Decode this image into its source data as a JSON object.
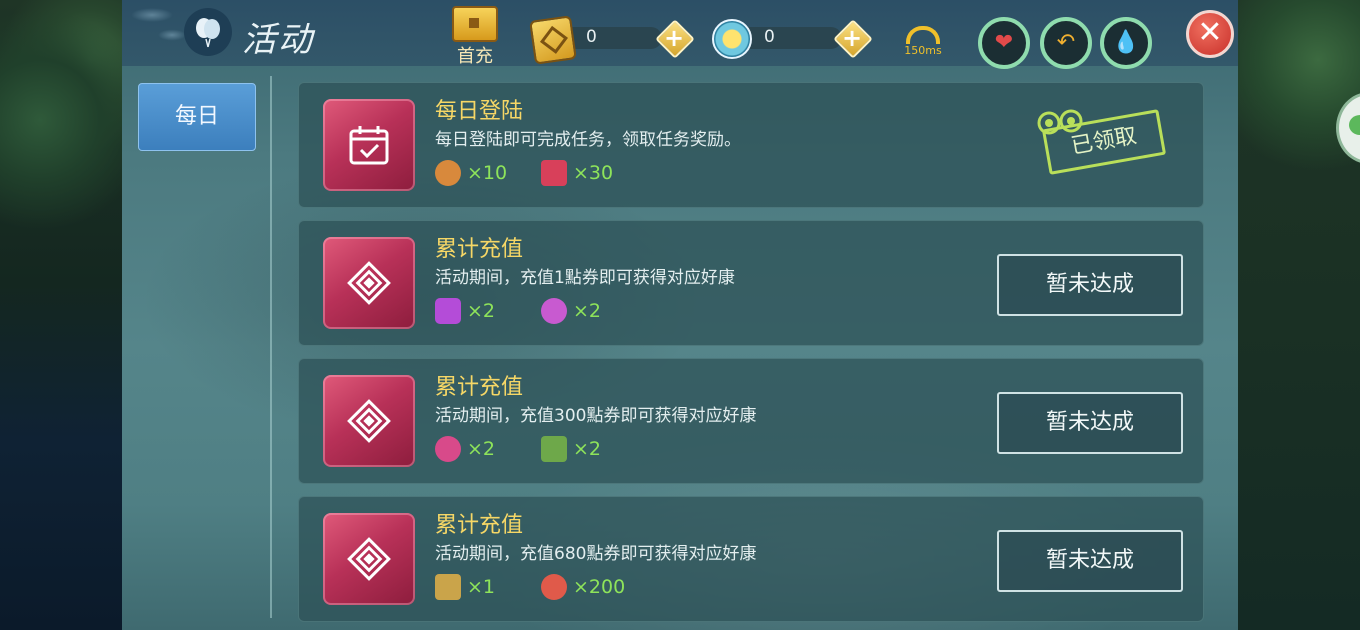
{
  "header": {
    "title": "活动",
    "first_recharge_label": "首充",
    "gold_amount": "0",
    "sun_amount": "0",
    "ping": "150ms"
  },
  "sidebar": {
    "tabs": [
      {
        "label": "每日",
        "active": true
      }
    ]
  },
  "tasks": [
    {
      "title": "每日登陆",
      "desc": "每日登陆即可完成任务，领取任务奖励。",
      "rewards": [
        {
          "icon": "food-bowl-icon",
          "qty": "×10",
          "color": "#d8893c"
        },
        {
          "icon": "pet-food-bag-icon",
          "qty": "×30",
          "color": "#d8405a"
        }
      ],
      "status": "已领取",
      "claimed": true
    },
    {
      "title": "累计充值",
      "desc": "活动期间，充值1點券即可获得对应好康",
      "rewards": [
        {
          "icon": "purple-crystal-icon",
          "qty": "×2",
          "color": "#b44cd8"
        },
        {
          "icon": "purple-gem-icon",
          "qty": "×2",
          "color": "#c85ad0"
        }
      ],
      "status": "暂未达成",
      "claimed": false
    },
    {
      "title": "累计充值",
      "desc": "活动期间，充值300點券即可获得对应好康",
      "rewards": [
        {
          "icon": "pink-potion-icon",
          "qty": "×2",
          "color": "#d84a8a"
        },
        {
          "icon": "gift-box-icon",
          "qty": "×2",
          "color": "#6ea84a"
        }
      ],
      "status": "暂未达成",
      "claimed": false
    },
    {
      "title": "累计充值",
      "desc": "活动期间，充值680點券即可获得对应好康",
      "rewards": [
        {
          "icon": "treasure-chest-icon",
          "qty": "×1",
          "color": "#caa44a"
        },
        {
          "icon": "candy-icon",
          "qty": "×200",
          "color": "#e05a4a"
        }
      ],
      "status": "暂未达成",
      "claimed": false
    }
  ],
  "colors": {
    "title_yellow": "#f6d766",
    "reward_green": "#8ee45a",
    "tab_blue": "#4a8ecb",
    "close_red": "#d8403a"
  }
}
